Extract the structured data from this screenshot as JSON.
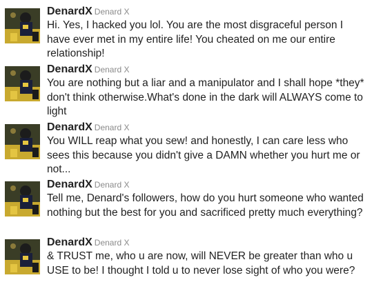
{
  "tweets": [
    {
      "display_name": "DenardX",
      "screen_name": "Denard X",
      "avatar_icon": "football-player-avatar",
      "text": "Hi. Yes, I hacked you lol. You are the most disgraceful person I have ever met in my entire life! You cheated on me our entire relationship!"
    },
    {
      "display_name": "DenardX",
      "screen_name": "Denard X",
      "avatar_icon": "football-player-avatar",
      "text": "You are nothing but a liar and a manipulator and I shall hope *they* don't think otherwise.What's done in the dark will ALWAYS come to light"
    },
    {
      "display_name": "DenardX",
      "screen_name": "Denard X",
      "avatar_icon": "football-player-avatar",
      "text": "You WILL reap what you sew! and honestly, I can care less who sees this because you didn't give a DAMN whether you hurt me or not..."
    },
    {
      "display_name": "DenardX",
      "screen_name": "Denard X",
      "avatar_icon": "football-player-avatar",
      "text": "Tell me, Denard's followers, how do you hurt someone who wanted nothing but the best for you and sacrificed pretty much everything?"
    },
    {
      "display_name": "DenardX",
      "screen_name": "Denard X",
      "avatar_icon": "football-player-avatar",
      "text": "& TRUST me, who u are now, will NEVER be greater than who u USE to be! I thought I told u to never lose sight of who you were?"
    }
  ]
}
